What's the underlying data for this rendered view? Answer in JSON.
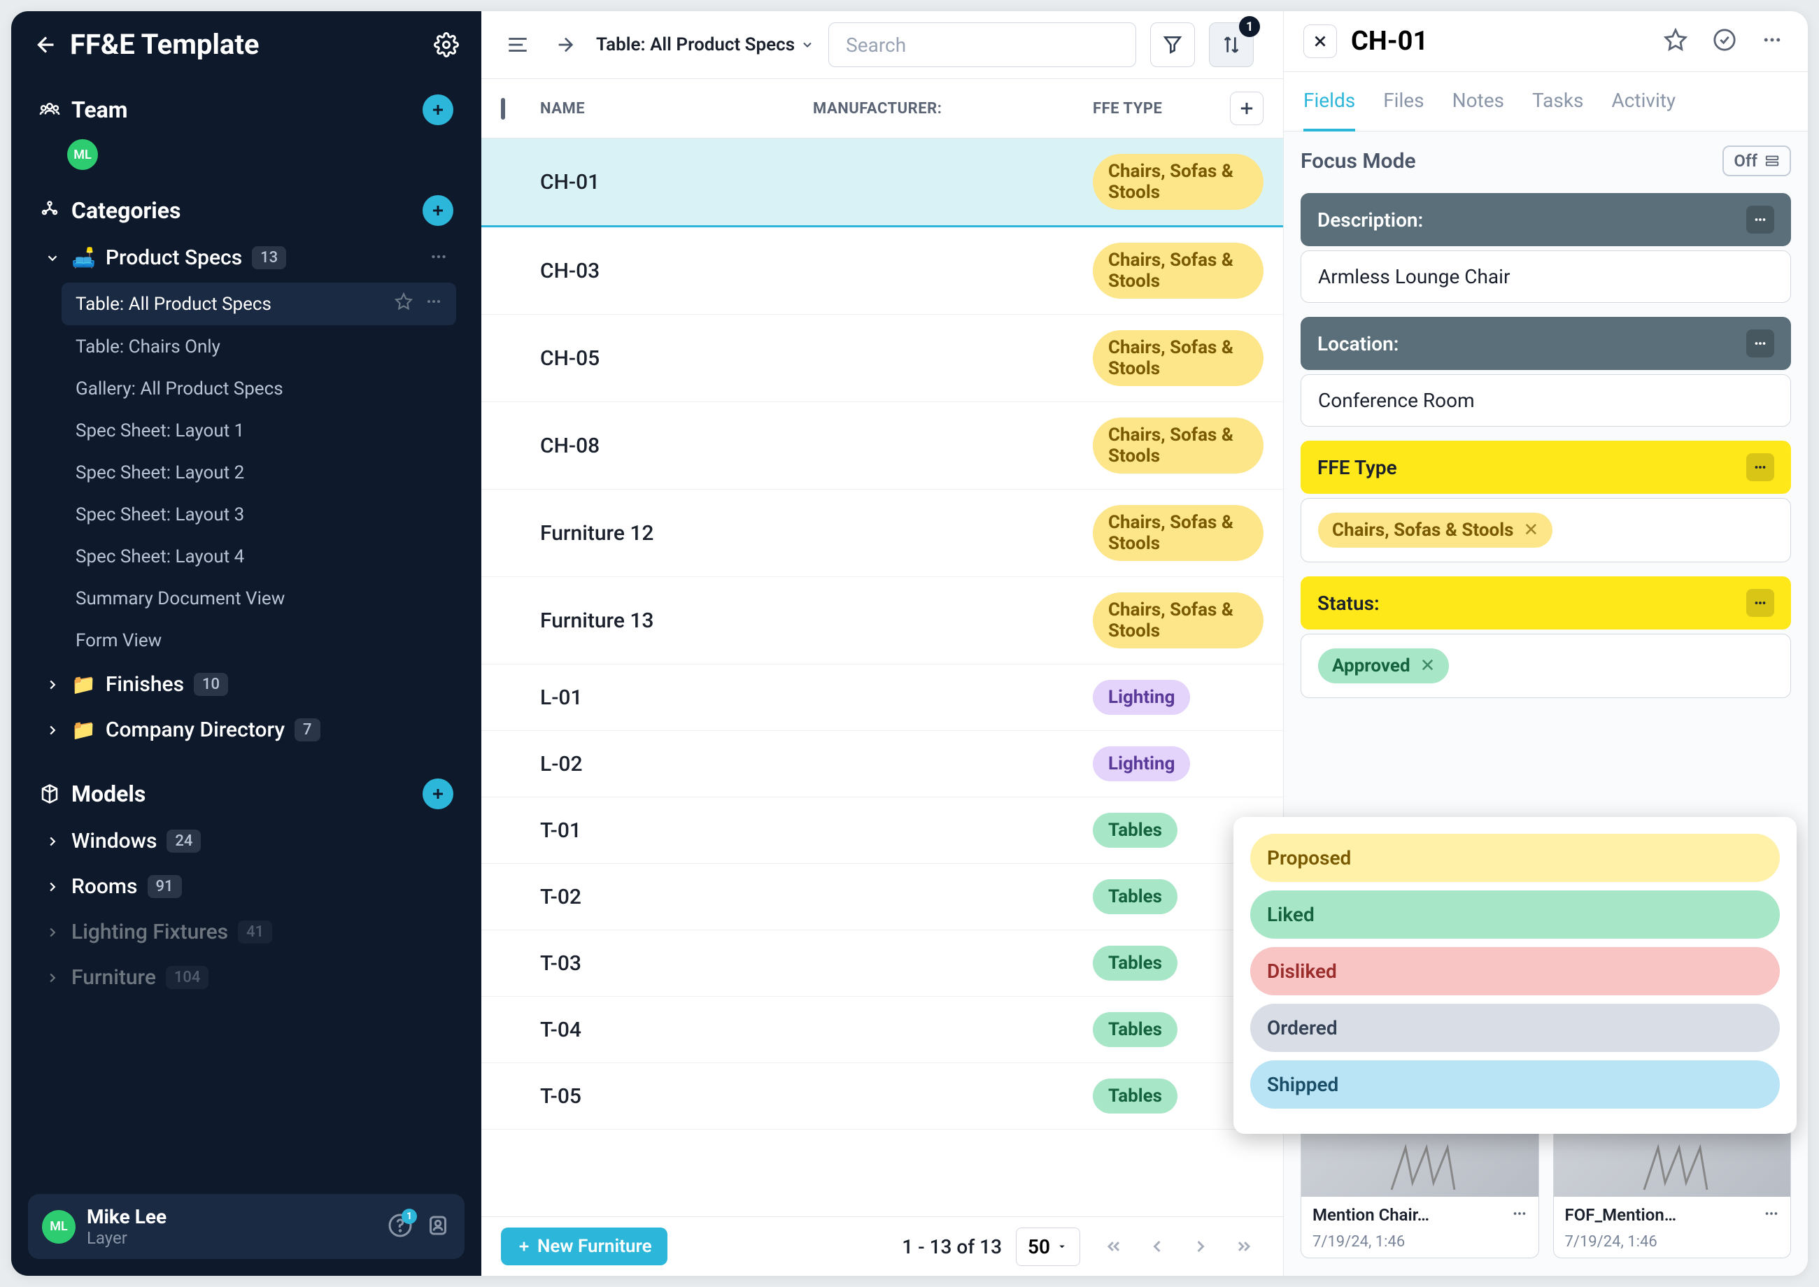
{
  "header": {
    "title": "FF&E Template"
  },
  "team": {
    "label": "Team",
    "avatar": "ML"
  },
  "categories": {
    "label": "Categories",
    "items": [
      {
        "emoji": "🛋️",
        "label": "Product Specs",
        "count": "13",
        "expanded": true,
        "children": [
          {
            "label": "Table: All Product Specs",
            "active": true
          },
          {
            "label": "Table: Chairs Only"
          },
          {
            "label": "Gallery: All Product Specs"
          },
          {
            "label": "Spec Sheet: Layout 1"
          },
          {
            "label": "Spec Sheet: Layout 2"
          },
          {
            "label": "Spec Sheet: Layout 3"
          },
          {
            "label": "Spec Sheet: Layout 4"
          },
          {
            "label": "Summary Document View"
          },
          {
            "label": "Form View"
          }
        ]
      },
      {
        "emoji": "📁",
        "label": "Finishes",
        "count": "10"
      },
      {
        "emoji": "📁",
        "label": "Company Directory",
        "count": "7"
      }
    ]
  },
  "models": {
    "label": "Models",
    "items": [
      {
        "label": "Windows",
        "count": "24"
      },
      {
        "label": "Rooms",
        "count": "91"
      },
      {
        "label": "Lighting Fixtures",
        "count": "41"
      },
      {
        "label": "Furniture",
        "count": "104"
      }
    ]
  },
  "user": {
    "avatar": "ML",
    "name": "Mike Lee",
    "role": "Layer",
    "help_count": "1"
  },
  "toolbar": {
    "crumb": "Table: All Product Specs",
    "search_placeholder": "Search",
    "sort_badge": "1"
  },
  "table": {
    "cols": {
      "name": "NAME",
      "manufacturer": "MANUFACTURER:",
      "type": "FFE TYPE"
    },
    "rows": [
      {
        "name": "CH-01",
        "type": "Chairs, Sofas & Stools",
        "type_class": "chairs",
        "selected": true
      },
      {
        "name": "CH-03",
        "type": "Chairs, Sofas & Stools",
        "type_class": "chairs"
      },
      {
        "name": "CH-05",
        "type": "Chairs, Sofas & Stools",
        "type_class": "chairs"
      },
      {
        "name": "CH-08",
        "type": "Chairs, Sofas & Stools",
        "type_class": "chairs"
      },
      {
        "name": "Furniture 12",
        "type": "Chairs, Sofas & Stools",
        "type_class": "chairs"
      },
      {
        "name": "Furniture 13",
        "type": "Chairs, Sofas & Stools",
        "type_class": "chairs"
      },
      {
        "name": "L-01",
        "type": "Lighting",
        "type_class": "lighting"
      },
      {
        "name": "L-02",
        "type": "Lighting",
        "type_class": "lighting"
      },
      {
        "name": "T-01",
        "type": "Tables",
        "type_class": "tables"
      },
      {
        "name": "T-02",
        "type": "Tables",
        "type_class": "tables"
      },
      {
        "name": "T-03",
        "type": "Tables",
        "type_class": "tables"
      },
      {
        "name": "T-04",
        "type": "Tables",
        "type_class": "tables"
      },
      {
        "name": "T-05",
        "type": "Tables",
        "type_class": "tables"
      }
    ],
    "footer": {
      "new_label": "New Furniture",
      "range": "1 - 13 of 13",
      "pagesize": "50"
    }
  },
  "detail": {
    "title": "CH-01",
    "tabs": [
      "Fields",
      "Files",
      "Notes",
      "Tasks",
      "Activity"
    ],
    "focus_mode": {
      "label": "Focus Mode",
      "toggle": "Off"
    },
    "fields": {
      "description": {
        "label": "Description:",
        "value": "Armless Lounge Chair"
      },
      "location": {
        "label": "Location:",
        "value": "Conference Room"
      },
      "ffe_type": {
        "label": "FFE Type",
        "value": "Chairs, Sofas & Stools"
      },
      "status": {
        "label": "Status:",
        "value": "Approved"
      }
    },
    "status_options": [
      {
        "label": "Proposed",
        "class": "proposed"
      },
      {
        "label": "Liked",
        "class": "liked"
      },
      {
        "label": "Disliked",
        "class": "disliked"
      },
      {
        "label": "Ordered",
        "class": "ordered"
      },
      {
        "label": "Shipped",
        "class": "shipped"
      }
    ],
    "thumbs": [
      {
        "name": "Mention Chair…",
        "date": "7/19/24, 1:46"
      },
      {
        "name": "FOF_Mention…",
        "date": "7/19/24, 1:46"
      }
    ]
  }
}
